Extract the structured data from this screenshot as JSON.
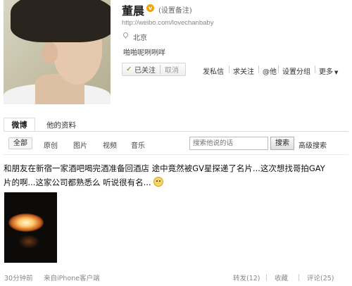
{
  "profile": {
    "name": "董晨",
    "vip_badge": "v",
    "remark_link": "(设置备注)",
    "url": "http://weibo.com/lovechanbaby",
    "location": "北京",
    "bio": "啪啪呢咧咧咩",
    "followed_label": "已关注",
    "cancel_label": "取消",
    "actions": [
      "发私信",
      "求关注",
      "@他",
      "设置分组",
      "更多"
    ]
  },
  "tabs": [
    {
      "label": "微博",
      "active": true
    },
    {
      "label": "他的资料",
      "active": false
    }
  ],
  "filters": [
    "全部",
    "原创",
    "图片",
    "视频",
    "音乐"
  ],
  "search": {
    "placeholder": "搜索他说的话",
    "button_label": "搜索",
    "advanced_label": "高级搜索"
  },
  "post": {
    "text_line1": "和朋友在新宿一家酒吧喝完酒准备回酒店 途中竟然被GV星探递了名片...这次想找哥拍GAY",
    "text_line2": "片的啊...这家公司都熟悉么 听说很有名...",
    "time": "30分钟前",
    "source": "来自iPhone客户端",
    "repost": "转发(12)",
    "favorite": "收藏",
    "comment": "评论(25)"
  },
  "colors": {
    "vip": "#f0a400",
    "text": "#333333",
    "muted": "#888888"
  }
}
